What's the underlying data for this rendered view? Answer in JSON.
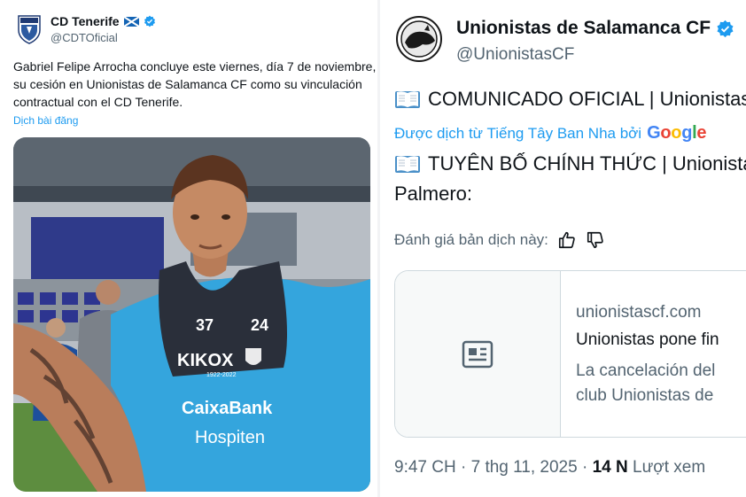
{
  "left_tweet": {
    "name": "CD Tenerife",
    "handle": "@CDTOficial",
    "text_lines": [
      "Gabriel Felipe Arrocha concluye este viernes, día 7 de noviembre,",
      "su cesión en Unionistas de Salamanca CF como su vinculación",
      "contractual con el CD Tenerife."
    ],
    "translate_link": "Dịch bài đăng",
    "photo": {
      "shirt_numbers": [
        "37",
        "24"
      ],
      "sponsor_main": "KIKOX",
      "sponsor_year": "1922-2022",
      "sponsor_bank": "CaixaBank",
      "sponsor_hospital": "Hospiten"
    }
  },
  "right_tweet": {
    "name": "Unionistas de Salamanca CF",
    "handle": "@UnionistasCF",
    "line1": "COMUNICADO OFICIAL | Unionistas",
    "translated_by": "Được dịch từ Tiếng Tây Ban Nha bởi",
    "google_letters": [
      "G",
      "o",
      "o",
      "g",
      "l",
      "e"
    ],
    "google_colors": [
      "#4285F4",
      "#EA4335",
      "#FBBC05",
      "#4285F4",
      "#34A853",
      "#EA4335"
    ],
    "line2": "TUYÊN BỐ CHÍNH THỨC | Unionistas",
    "line3": "Palmero:",
    "rate_prompt": "Đánh giá bản dịch này:",
    "card": {
      "domain": "unionistascf.com",
      "title": "Unionistas pone fin",
      "desc_lines": [
        "La cancelación del",
        "club Unionistas de"
      ]
    },
    "meta": {
      "time": "9:47 CH",
      "date": "7 thg 11, 2025",
      "views_count": "14 N",
      "views_label": "Lượt xem"
    }
  },
  "colors": {
    "accent": "#1d9bf0",
    "text": "#0f1419",
    "muted": "#536471"
  }
}
